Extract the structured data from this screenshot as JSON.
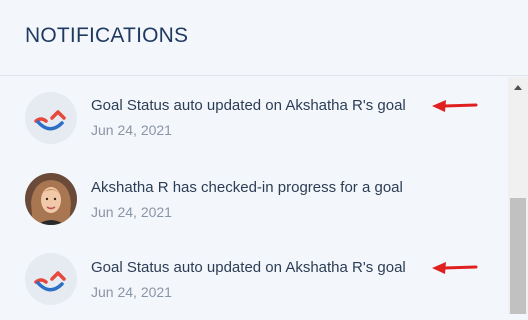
{
  "header": {
    "title": "NOTIFICATIONS"
  },
  "notifications": [
    {
      "avatar": "app-logo-icon",
      "text": "Goal Status auto updated on Akshatha R's goal",
      "date": "Jun 24, 2021",
      "annotation": "red-arrow"
    },
    {
      "avatar": "user-photo",
      "text": "Akshatha R has checked-in progress for a goal",
      "date": "Jun 24, 2021"
    },
    {
      "avatar": "app-logo-icon",
      "text": "Goal Status auto updated on Akshatha R's goal",
      "date": "Jun 24, 2021",
      "annotation": "red-arrow"
    }
  ],
  "colors": {
    "header_text": "#1f3a5f",
    "body_text": "#2c3e55",
    "date_text": "#8a96a6",
    "background": "#f3f6fb",
    "logo_red": "#e8473b",
    "logo_blue": "#2d6fc7",
    "annotation_red": "#e02020"
  }
}
